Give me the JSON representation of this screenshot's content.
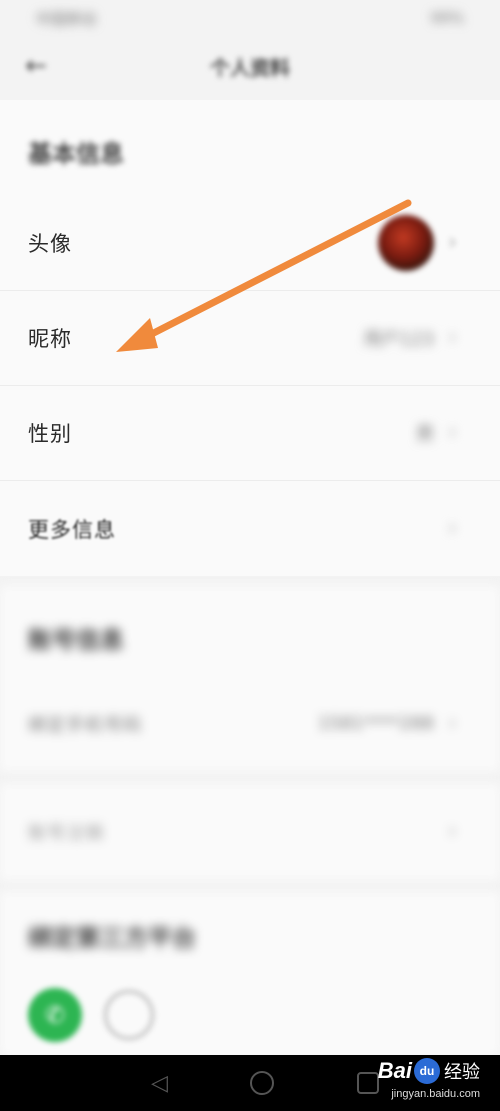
{
  "status_bar": {
    "left": "中国移动",
    "right": "99%"
  },
  "nav": {
    "title": "个人资料"
  },
  "basic_section": {
    "header": "基本信息",
    "rows": [
      {
        "label": "头像",
        "value": ""
      },
      {
        "label": "昵称",
        "value": "用户123"
      },
      {
        "label": "性别",
        "value": "男"
      },
      {
        "label": "更多信息",
        "value": ""
      }
    ]
  },
  "account_section": {
    "header": "账号信息",
    "rows": [
      {
        "label": "绑定手机号码",
        "value": "1581****288"
      }
    ]
  },
  "extra_row": {
    "label": "账号注销"
  },
  "platform_section": {
    "header": "绑定第三方平台"
  },
  "watermark": {
    "brand_left": "Bai",
    "brand_mid": "du",
    "brand_right": "经验",
    "url": "jingyan.baidu.com"
  },
  "colors": {
    "arrow": "#f08a3c",
    "wechat": "#2db552",
    "background": "#f3f3f3"
  }
}
